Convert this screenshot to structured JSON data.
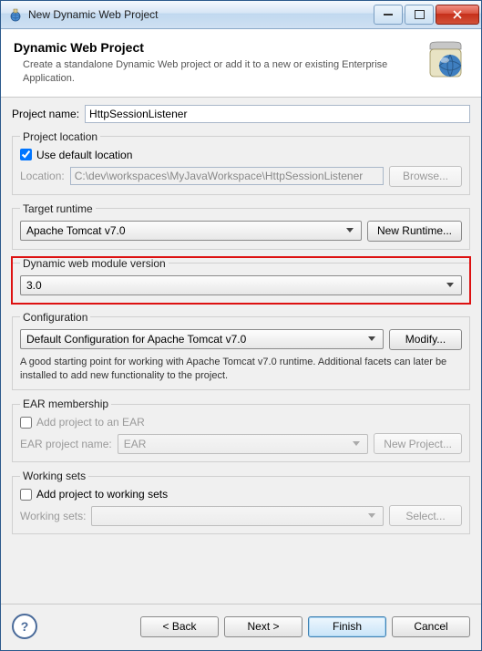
{
  "window": {
    "title": "New Dynamic Web Project"
  },
  "header": {
    "title": "Dynamic Web Project",
    "description": "Create a standalone Dynamic Web project or add it to a new or existing Enterprise Application."
  },
  "project_name": {
    "label": "Project name:",
    "value": "HttpSessionListener"
  },
  "project_location": {
    "legend": "Project location",
    "use_default_label": "Use default location",
    "use_default_checked": true,
    "location_label": "Location:",
    "location_value": "C:\\dev\\workspaces\\MyJavaWorkspace\\HttpSessionListener",
    "browse_label": "Browse..."
  },
  "target_runtime": {
    "legend": "Target runtime",
    "value": "Apache Tomcat v7.0",
    "new_runtime_label": "New Runtime..."
  },
  "web_module": {
    "legend": "Dynamic web module version",
    "value": "3.0"
  },
  "configuration": {
    "legend": "Configuration",
    "value": "Default Configuration for Apache Tomcat v7.0",
    "modify_label": "Modify...",
    "description": "A good starting point for working with Apache Tomcat v7.0 runtime. Additional facets can later be installed to add new functionality to the project."
  },
  "ear": {
    "legend": "EAR membership",
    "add_label": "Add project to an EAR",
    "add_checked": false,
    "project_label": "EAR project name:",
    "project_value": "EAR",
    "new_project_label": "New Project..."
  },
  "working_sets": {
    "legend": "Working sets",
    "add_label": "Add project to working sets",
    "add_checked": false,
    "label": "Working sets:",
    "value": "",
    "select_label": "Select..."
  },
  "buttons": {
    "back": "< Back",
    "next": "Next >",
    "finish": "Finish",
    "cancel": "Cancel"
  }
}
